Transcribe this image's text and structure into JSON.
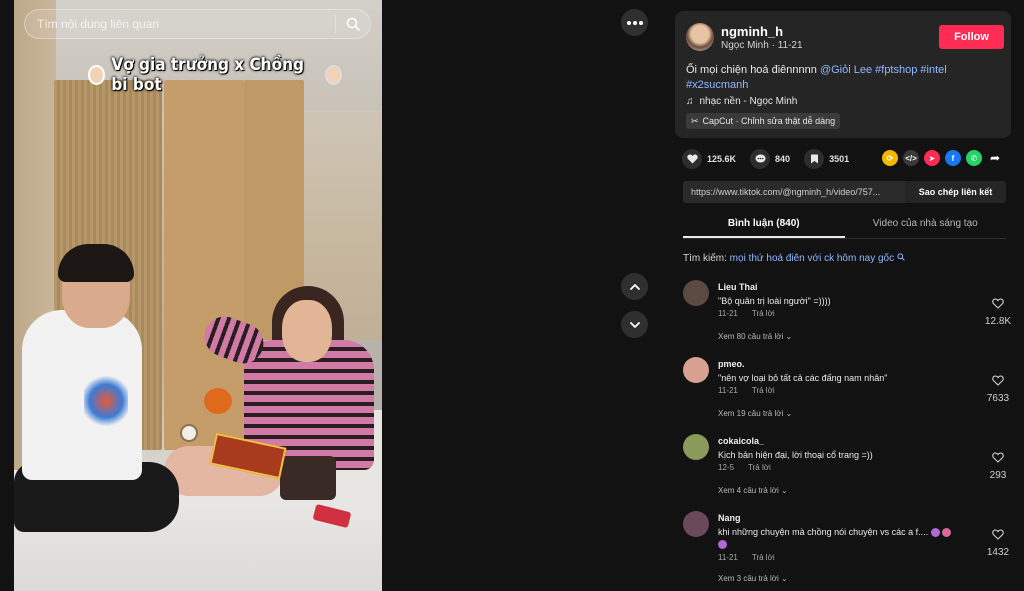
{
  "search": {
    "placeholder": "Tìm nội dung liên quan"
  },
  "video": {
    "caption": "Vợ gia trưởng x Chồng bi bot"
  },
  "author": {
    "username": "ngminh_h",
    "display_name": "Ngọc Minh",
    "date": "11-21",
    "follow_label": "Follow"
  },
  "description": {
    "text": "Ối mọi chiện hoá điênnnnn",
    "mention": "@Giỏi Lee",
    "tags": [
      "#fptshop",
      "#intel",
      "#x2sucmanh"
    ]
  },
  "music": {
    "label": "nhạc nền - Ngọc Minh"
  },
  "capcut": {
    "label": "CapCut · Chỉnh sửa thật dễ dàng"
  },
  "stats": {
    "likes": "125.6K",
    "comments": "840",
    "saves": "3501"
  },
  "share_icons": [
    "tiktok-share-icon",
    "embed-icon",
    "send-icon",
    "facebook-icon",
    "whatsapp-icon",
    "share-arrow-icon"
  ],
  "link": {
    "url": "https://www.tiktok.com/@ngminh_h/video/757...",
    "copy_label": "Sao chép liên kết"
  },
  "tabs": [
    {
      "label": "Bình luận (840)",
      "active": true
    },
    {
      "label": "Video của nhà sáng tạo",
      "active": false
    }
  ],
  "search_suggest": {
    "prefix": "Tìm kiếm:",
    "query": "mọi thứ hoá điên với ck hôm nay gốc"
  },
  "comments": [
    {
      "user": "Lieu Thai",
      "text": "\"Bộ quân trị loài người\" =))))",
      "date": "11-21",
      "reply_label": "Trả lời",
      "replies": "Xem 80 câu trả lời",
      "likes": "12.8K",
      "avatar_color": "#5a4a42"
    },
    {
      "user": "pmeo.",
      "text": "\"nên vợ loại bỏ tất cả các đấng nam nhân\"",
      "date": "11-21",
      "reply_label": "Trả lời",
      "replies": "Xem 19 câu trả lời",
      "likes": "7633",
      "avatar_color": "#d8a090"
    },
    {
      "user": "cokaicola_",
      "text": "Kịch bản hiện đại, lời thoại cổ trang =))",
      "date": "12-5",
      "reply_label": "Trả lời",
      "replies": "Xem 4 câu trả lời",
      "likes": "293",
      "avatar_color": "#8a9a5a"
    },
    {
      "user": "Nang",
      "text": "khi những chuyện mà chồng nói chuyện vs các a f....",
      "date": "11-21",
      "reply_label": "Trả lời",
      "replies": "Xem 3 câu trả lời",
      "likes": "1432",
      "avatar_color": "#6a4a5a"
    }
  ]
}
